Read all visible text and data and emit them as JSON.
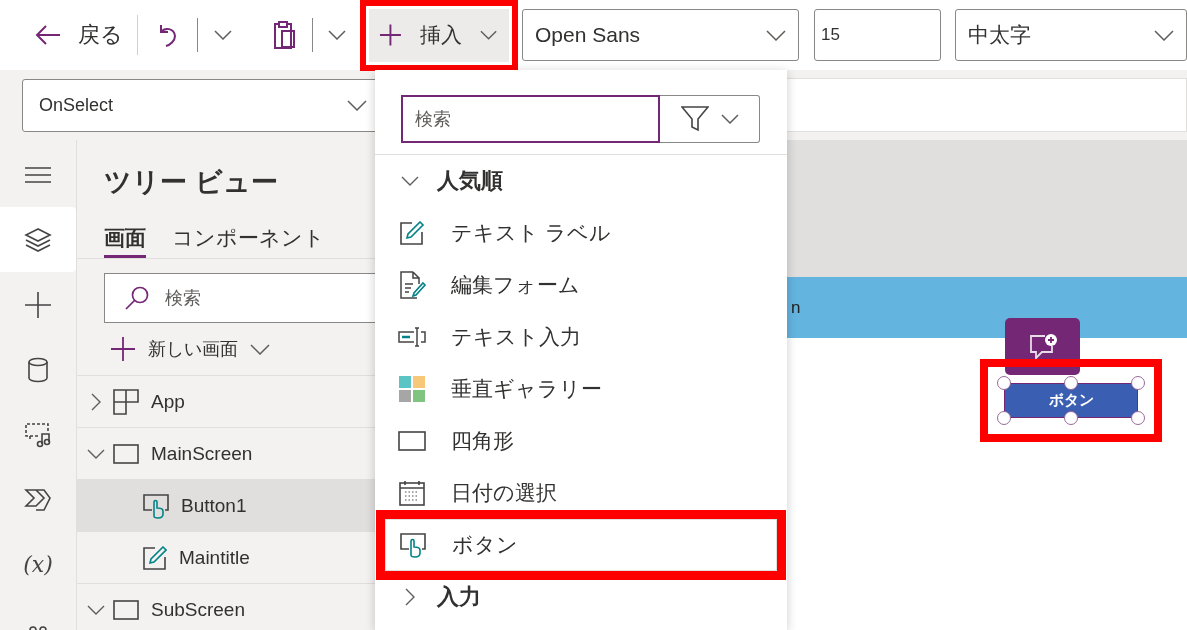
{
  "toolbar": {
    "back": "戻る",
    "insert": {
      "label": "挿入",
      "highlighted": true
    },
    "font": "Open Sans",
    "font_size": "15",
    "font_weight": "中太字"
  },
  "formula_bar": {
    "property": "OnSelect"
  },
  "rail": [
    {
      "kind": "menu",
      "selected": false
    },
    {
      "kind": "layers",
      "selected": true
    },
    {
      "kind": "plus",
      "selected": false
    },
    {
      "kind": "database",
      "selected": false
    },
    {
      "kind": "media",
      "selected": false
    },
    {
      "kind": "automate",
      "selected": false
    },
    {
      "kind": "variables",
      "glyph": "(x)",
      "selected": false
    },
    {
      "kind": "tools",
      "selected": false
    }
  ],
  "tree_panel": {
    "title": "ツリー ビュー",
    "tabs": [
      {
        "label": "画面",
        "selected": true
      },
      {
        "label": "コンポーネント",
        "selected": false
      }
    ],
    "search": {
      "placeholder": "検索"
    },
    "new_screen": "新しい画面",
    "nodes": [
      {
        "label": "App",
        "kind": "app",
        "expanded": false,
        "selected": false
      },
      {
        "label": "MainScreen",
        "kind": "screen",
        "expanded": true,
        "selected": false,
        "children": [
          {
            "label": "Button1",
            "kind": "button",
            "selected": true
          },
          {
            "label": "Maintitle",
            "kind": "label",
            "selected": false
          }
        ]
      },
      {
        "label": "SubScreen",
        "kind": "screen",
        "expanded": true,
        "selected": false
      }
    ]
  },
  "insert_menu": {
    "search": {
      "placeholder": "検索"
    },
    "groups": [
      {
        "label": "人気順",
        "expanded": true,
        "items": [
          {
            "label": "テキスト ラベル",
            "kind": "label",
            "highlighted": false
          },
          {
            "label": "編集フォーム",
            "kind": "form",
            "highlighted": false
          },
          {
            "label": "テキスト入力",
            "kind": "textinput",
            "highlighted": false
          },
          {
            "label": "垂直ギャラリー",
            "kind": "gallery",
            "highlighted": false
          },
          {
            "label": "四角形",
            "kind": "rectangle",
            "highlighted": false
          },
          {
            "label": "日付の選択",
            "kind": "date",
            "highlighted": false
          },
          {
            "label": "ボタン",
            "kind": "button",
            "highlighted": true
          }
        ]
      },
      {
        "label": "入力",
        "expanded": false
      }
    ]
  },
  "canvas": {
    "header_title": "n",
    "control": {
      "label": "ボタン",
      "selected": true,
      "highlighted": true
    }
  }
}
